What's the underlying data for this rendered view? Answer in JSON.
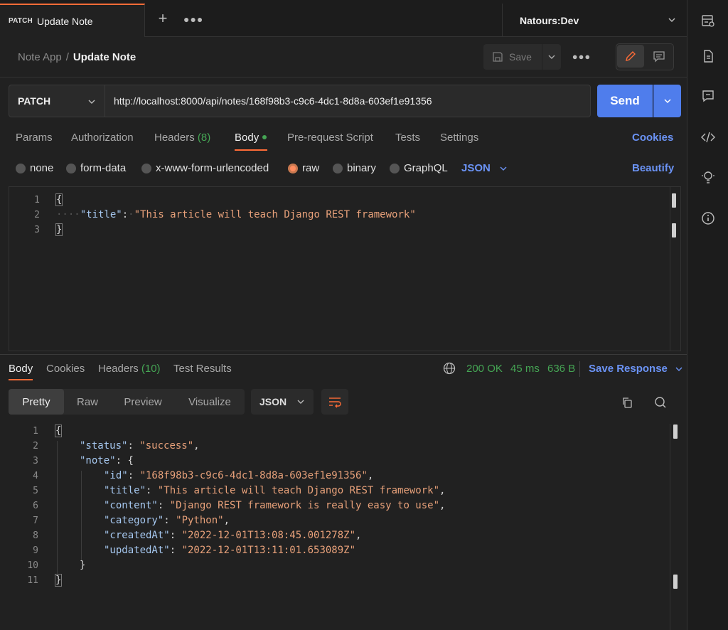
{
  "tab": {
    "method": "PATCH",
    "title": "Update Note"
  },
  "environment": "Natours:Dev",
  "breadcrumb": {
    "parent": "Note App",
    "separator": "/",
    "current": "Update Note"
  },
  "toolbar": {
    "save_label": "Save"
  },
  "request": {
    "method": "PATCH",
    "url": "http://localhost:8000/api/notes/168f98b3-c9c6-4dc1-8d8a-603ef1e91356",
    "send_label": "Send"
  },
  "request_tabs": {
    "params": "Params",
    "authorization": "Authorization",
    "headers": "Headers",
    "headers_count": "(8)",
    "body": "Body",
    "prerequest": "Pre-request Script",
    "tests": "Tests",
    "settings": "Settings",
    "cookies": "Cookies"
  },
  "body_types": {
    "none": "none",
    "form_data": "form-data",
    "urlencoded": "x-www-form-urlencoded",
    "raw": "raw",
    "binary": "binary",
    "graphql": "GraphQL",
    "selected": "raw",
    "format": "JSON",
    "beautify": "Beautify"
  },
  "request_body": {
    "line_numbers": [
      "1",
      "2",
      "3"
    ],
    "open": "{",
    "key": "\"title\"",
    "colon": ":",
    "value": "\"This article will teach Django REST framework\"",
    "close": "}"
  },
  "response_tabs": {
    "body": "Body",
    "cookies": "Cookies",
    "headers": "Headers",
    "headers_count": "(10)",
    "test_results": "Test Results"
  },
  "response_meta": {
    "status": "200 OK",
    "time": "45 ms",
    "size": "636 B",
    "save_response": "Save Response"
  },
  "view_modes": {
    "pretty": "Pretty",
    "raw": "Raw",
    "preview": "Preview",
    "visualize": "Visualize",
    "format": "JSON"
  },
  "response_body": {
    "line_numbers": [
      "1",
      "2",
      "3",
      "4",
      "5",
      "6",
      "7",
      "8",
      "9",
      "10",
      "11"
    ],
    "l1": "{",
    "status_key": "\"status\"",
    "status_val": "\"success\"",
    "note_key": "\"note\"",
    "note_open": "{",
    "id_key": "\"id\"",
    "id_val": "\"168f98b3-c9c6-4dc1-8d8a-603ef1e91356\"",
    "title_key": "\"title\"",
    "title_val": "\"This article will teach Django REST framework\"",
    "content_key": "\"content\"",
    "content_val": "\"Django REST framework is really easy to use\"",
    "category_key": "\"category\"",
    "category_val": "\"Python\"",
    "created_key": "\"createdAt\"",
    "created_val": "\"2022-12-01T13:08:45.001278Z\"",
    "updated_key": "\"updatedAt\"",
    "updated_val": "\"2022-12-01T13:11:01.653089Z\"",
    "note_close": "}",
    "l11": "}"
  },
  "colors": {
    "accent": "#ff6c37",
    "send": "#4f7dec",
    "link": "#6b93f5",
    "success": "#45a554",
    "json_key": "#a6c8f0",
    "json_string": "#e8a17a"
  },
  "icons": {
    "new_tab": "plus-icon",
    "tab_more": "ellipsis-icon",
    "env": "chevron-down-icon",
    "save": "save-disk-icon",
    "edit": "pencil-icon",
    "doc": "comment-doc-icon",
    "sidebar": [
      "environment-quicklook-icon",
      "documentation-icon",
      "comments-icon",
      "code-icon",
      "related-collections-icon",
      "info-icon"
    ],
    "globe": "globe-icon",
    "copy": "copy-icon",
    "search": "search-icon",
    "wrap": "wrap-lines-icon"
  }
}
